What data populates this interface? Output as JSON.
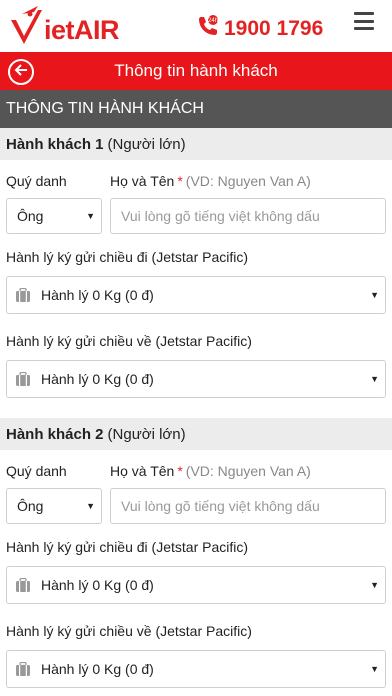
{
  "brand": {
    "logo_text": "ietAIR",
    "accent": "#e8161b"
  },
  "hotline": {
    "number": "1900 1796"
  },
  "titlebar": {
    "title": "Thông tin hành khách"
  },
  "section": {
    "title": "THÔNG TIN HÀNH KHÁCH"
  },
  "form": {
    "title_label": "Quý danh",
    "name_label": "Họ và Tên",
    "required_mark": "*",
    "name_hint": "(VD: Nguyen Van A)",
    "name_placeholder": "Vui lòng gõ tiếng việt không dấu",
    "bag_out_label": "Hành lý ký gửi chiều đi (Jetstar Pacific)",
    "bag_ret_label": "Hành lý ký gửi chiều về (Jetstar Pacific)"
  },
  "passengers": [
    {
      "heading": "Hành khách 1",
      "type": "(Người lớn)",
      "title_value": "Ông",
      "bag_out_value": "Hành lý 0 Kg (0 đ)",
      "bag_ret_value": "Hành lý 0 Kg (0 đ)"
    },
    {
      "heading": "Hành khách 2",
      "type": "(Người lớn)",
      "title_value": "Ông",
      "bag_out_value": "Hành lý 0 Kg (0 đ)",
      "bag_ret_value": "Hành lý 0 Kg (0 đ)"
    }
  ],
  "icons": {
    "phone": "phone-icon",
    "menu": "menu-icon",
    "back": "arrow-left-icon",
    "luggage": "luggage-icon"
  }
}
